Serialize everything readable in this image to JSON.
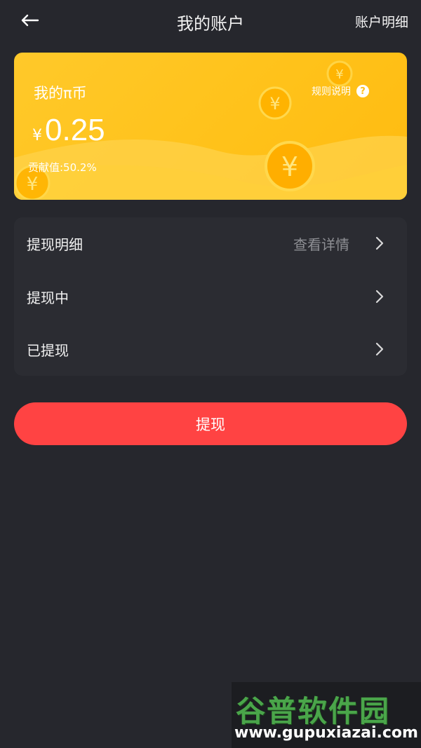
{
  "header": {
    "back_icon": "back-arrow-icon",
    "title": "我的账户",
    "detail_link": "账户明细"
  },
  "card": {
    "title": "我的π币",
    "rule_label": "规则说明",
    "rule_icon": "question-circle-icon",
    "currency_symbol": "¥",
    "amount": "0.25",
    "contribution": "贡献值:50.2%",
    "coin_icon": "yuan-coin-icon"
  },
  "list": {
    "rows": [
      {
        "label": "提现明细",
        "extra": "查看详情",
        "icon": "chevron-right-icon"
      },
      {
        "label": "提现中",
        "icon": "chevron-right-icon"
      },
      {
        "label": "已提现",
        "icon": "chevron-right-icon"
      }
    ]
  },
  "withdraw_button": "提现",
  "watermark": {
    "text": "谷普软件园",
    "url": "www.gupuxiazai.com"
  },
  "colors": {
    "background": "#26272d",
    "card_yellow": "#ffc21a",
    "button_red": "#ff4343",
    "list_bg": "#2b2c32",
    "muted_text": "#8e8f94"
  }
}
